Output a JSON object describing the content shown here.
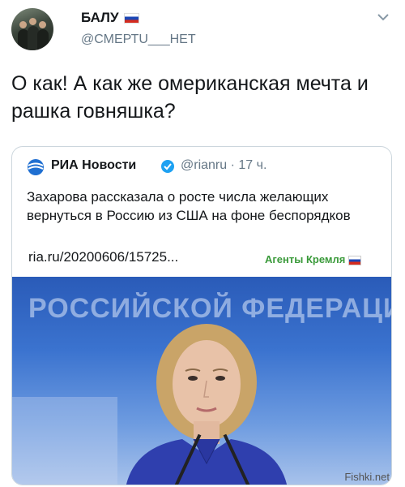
{
  "author": {
    "name": "БАЛУ",
    "handle": "@СМЕРТU___НЕТ"
  },
  "tweet": {
    "text": "О как! А как же омериканская мечта и рашка говняшка?"
  },
  "quoted": {
    "name": "РИА Новости",
    "handle": "@rianru · 17 ч.",
    "text": "Захарова рассказала о росте числа желающих вернуться в Россию из США на фоне беспорядков",
    "link": "ria.ru/20200606/15725...",
    "label": "Агенты Кремля",
    "photo_caption": "РОССИЙСКОЙ ФЕДЕРАЦИИ"
  },
  "watermark": "Fishki.net",
  "colors": {
    "verified": "#1da1f2",
    "label_green": "#3a9a3a",
    "handle_gray": "#657786"
  }
}
